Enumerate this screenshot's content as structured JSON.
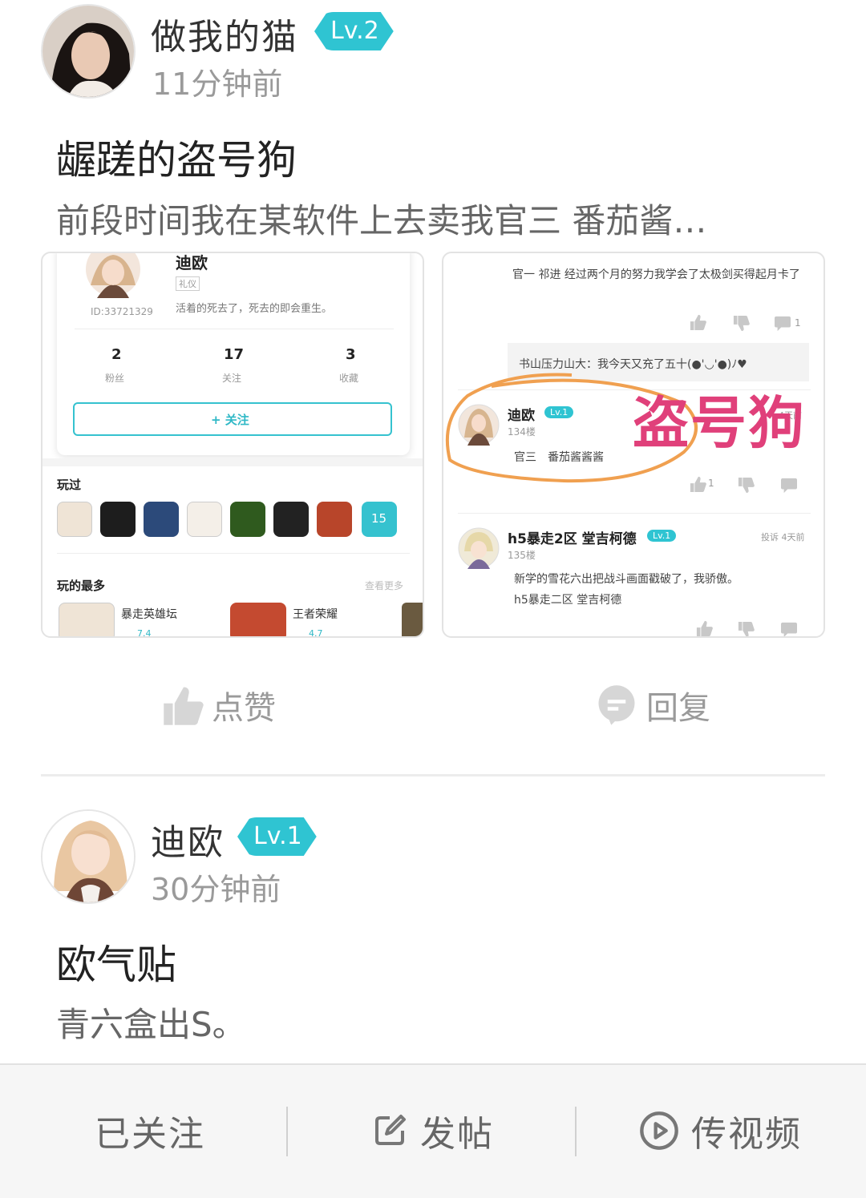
{
  "posts": [
    {
      "author": "做我的猫",
      "level": "Lv.2",
      "time": "11分钟前",
      "title": "龌蹉的盗号狗",
      "excerpt": "前段时间我在某软件上去卖我官三 番茄酱…",
      "actions": {
        "like": "点赞",
        "reply": "回复"
      },
      "screenshot_left": {
        "name": "迪欧",
        "tag": "礼仪",
        "id": "ID:33721329",
        "bio": "活着的死去了，死去的即会重生。",
        "stats": [
          {
            "value": "2",
            "label": "粉丝"
          },
          {
            "value": "17",
            "label": "关注"
          },
          {
            "value": "3",
            "label": "收藏"
          }
        ],
        "follow_button": "+ 关注",
        "played_title": "玩过",
        "played_count": "15",
        "most_played_title": "玩的最多",
        "see_more": "查看更多",
        "games": [
          {
            "name": "暴走英雄坛",
            "score": "7.4"
          },
          {
            "name": "王者荣耀",
            "score": "4.7"
          }
        ]
      },
      "screenshot_right": {
        "top_comment": "官一 祁进 经过两个月的努力我学会了太极剑买得起月卡了",
        "reply_count": "1",
        "quote": "书山压力山大：我今天又充了五十(●'◡'●)ﾉ♥",
        "c1_name": "迪欧",
        "c1_level": "Lv.1",
        "c1_floor": "134楼",
        "c1_text": "官三　番茄酱酱酱",
        "c1_likes": "1",
        "c1_time": "4天前",
        "overlay_text": "盗号狗",
        "c2_name": "h5暴走2区 堂吉柯德",
        "c2_level": "Lv.1",
        "c2_floor": "135楼",
        "c2_meta": "投诉  4天前",
        "c2_text1": "新学的雪花六出把战斗画面戳破了，我骄傲。",
        "c2_text2": "h5暴走二区 堂吉柯德"
      }
    },
    {
      "author": "迪欧",
      "level": "Lv.1",
      "time": "30分钟前",
      "title": "欧气贴",
      "excerpt": "青六盒出S。"
    }
  ],
  "bottom_bar": {
    "followed": "已关注",
    "post": "发帖",
    "video": "传视频"
  },
  "colors": {
    "accent": "#2fc4d2",
    "overlay_text": "#e0407a",
    "circle": "#f0a050"
  }
}
